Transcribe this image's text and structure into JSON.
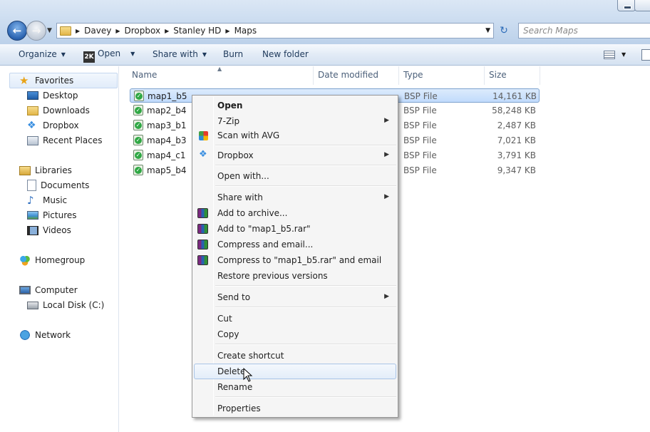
{
  "window": {
    "breadcrumb": [
      "Davey",
      "Dropbox",
      "Stanley HD",
      "Maps"
    ],
    "search_placeholder": "Search Maps"
  },
  "toolbar": {
    "organize": "Organize",
    "open": "Open",
    "open_icon_text": "2K",
    "share_with": "Share with",
    "burn": "Burn",
    "new_folder": "New folder"
  },
  "sidebar": {
    "favorites": "Favorites",
    "desktop": "Desktop",
    "downloads": "Downloads",
    "dropbox": "Dropbox",
    "recent_places": "Recent Places",
    "libraries": "Libraries",
    "documents": "Documents",
    "music": "Music",
    "pictures": "Pictures",
    "videos": "Videos",
    "homegroup": "Homegroup",
    "computer": "Computer",
    "local_disk": "Local Disk (C:)",
    "network": "Network"
  },
  "columns": {
    "name": "Name",
    "date_modified": "Date modified",
    "type": "Type",
    "size": "Size"
  },
  "files": [
    {
      "name": "map1_b5",
      "type": "BSP File",
      "size": "14,161 KB"
    },
    {
      "name": "map2_b4",
      "type": "BSP File",
      "size": "58,248 KB"
    },
    {
      "name": "map3_b1",
      "type": "BSP File",
      "size": "2,487 KB"
    },
    {
      "name": "map4_b3",
      "type": "BSP File",
      "size": "7,021 KB"
    },
    {
      "name": "map4_c1",
      "type": "BSP File",
      "size": "3,791 KB"
    },
    {
      "name": "map5_b4",
      "type": "BSP File",
      "size": "9,347 KB"
    }
  ],
  "context_menu": {
    "open": "Open",
    "seven_zip": "7-Zip",
    "scan_avg": "Scan with AVG",
    "dropbox": "Dropbox",
    "open_with": "Open with...",
    "share_with": "Share with",
    "add_archive": "Add to archive...",
    "add_rar": "Add to \"map1_b5.rar\"",
    "compress_email": "Compress and email...",
    "compress_rar_email": "Compress to \"map1_b5.rar\" and email",
    "restore": "Restore previous versions",
    "send_to": "Send to",
    "cut": "Cut",
    "copy": "Copy",
    "create_shortcut": "Create shortcut",
    "delete": "Delete",
    "rename": "Rename",
    "properties": "Properties"
  }
}
